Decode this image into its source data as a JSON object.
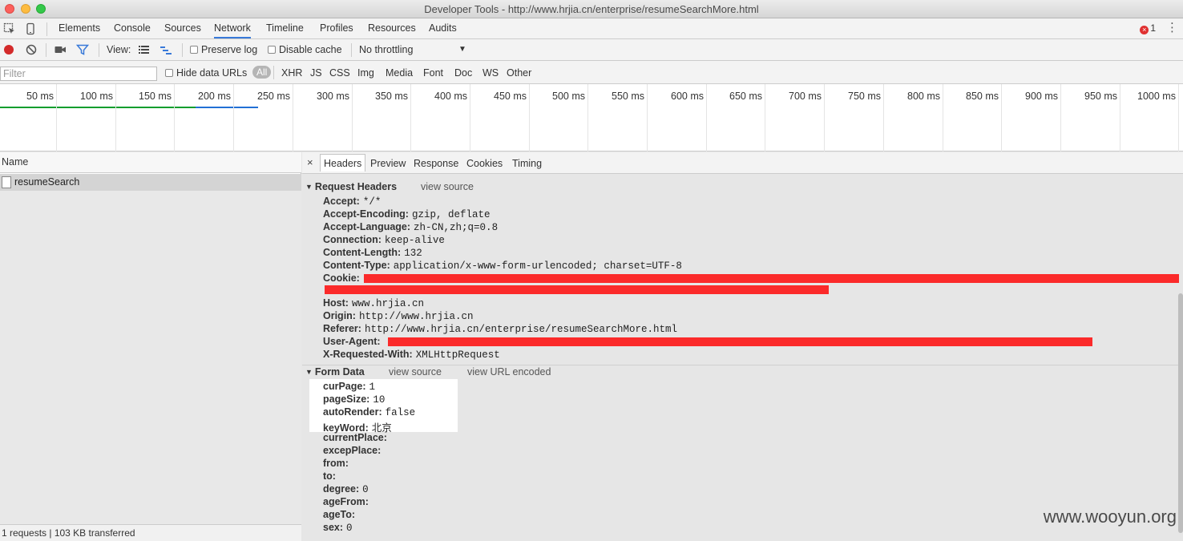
{
  "window": {
    "title": "Developer Tools - http://www.hrjia.cn/enterprise/resumeSearchMore.html"
  },
  "main_tabs": [
    "Elements",
    "Console",
    "Sources",
    "Network",
    "Timeline",
    "Profiles",
    "Resources",
    "Audits"
  ],
  "active_main_tab": "Network",
  "error_count": "1",
  "toolbar": {
    "view_label": "View:",
    "preserve_log": "Preserve log",
    "disable_cache": "Disable cache",
    "throttling": "No throttling",
    "preserve_log_checked": false,
    "disable_cache_checked": false
  },
  "filter": {
    "placeholder": "Filter",
    "hide_data_urls": "Hide data URLs",
    "types": [
      "All",
      "XHR",
      "JS",
      "CSS",
      "Img",
      "Media",
      "Font",
      "Doc",
      "WS",
      "Other"
    ]
  },
  "timeline": {
    "labels": [
      "50 ms",
      "100 ms",
      "150 ms",
      "200 ms",
      "250 ms",
      "300 ms",
      "350 ms",
      "400 ms",
      "450 ms",
      "500 ms",
      "550 ms",
      "600 ms",
      "650 ms",
      "700 ms",
      "750 ms",
      "800 ms",
      "850 ms",
      "900 ms",
      "950 ms",
      "1000 ms"
    ]
  },
  "requests": {
    "column_name": "Name",
    "items": [
      "resumeSearch"
    ],
    "status": "1 requests | 103 KB transferred"
  },
  "details": {
    "tabs": [
      "Headers",
      "Preview",
      "Response",
      "Cookies",
      "Timing"
    ],
    "active_tab": "Headers",
    "close": "×",
    "request_headers_title": "Request Headers",
    "view_source": "view source",
    "view_url_encoded": "view URL encoded",
    "form_data_title": "Form Data",
    "request_headers": [
      {
        "key": "Accept:",
        "value": "*/*"
      },
      {
        "key": "Accept-Encoding:",
        "value": "gzip, deflate"
      },
      {
        "key": "Accept-Language:",
        "value": "zh-CN,zh;q=0.8"
      },
      {
        "key": "Connection:",
        "value": "keep-alive"
      },
      {
        "key": "Content-Length:",
        "value": "132"
      },
      {
        "key": "Content-Type:",
        "value": "application/x-www-form-urlencoded; charset=UTF-8"
      },
      {
        "key": "Cookie:",
        "value": ""
      },
      {
        "key": "Host:",
        "value": "www.hrjia.cn"
      },
      {
        "key": "Origin:",
        "value": "http://www.hrjia.cn"
      },
      {
        "key": "Referer:",
        "value": "http://www.hrjia.cn/enterprise/resumeSearchMore.html"
      },
      {
        "key": "User-Agent:",
        "value": ""
      },
      {
        "key": "X-Requested-With:",
        "value": "XMLHttpRequest"
      }
    ],
    "form_data": [
      {
        "key": "curPage:",
        "value": "1"
      },
      {
        "key": "pageSize:",
        "value": "10"
      },
      {
        "key": "autoRender:",
        "value": "false"
      },
      {
        "key": "keyWord:",
        "value": "北京"
      },
      {
        "key": "currentPlace:",
        "value": ""
      },
      {
        "key": "excepPlace:",
        "value": ""
      },
      {
        "key": "from:",
        "value": ""
      },
      {
        "key": "to:",
        "value": ""
      },
      {
        "key": "degree:",
        "value": "0"
      },
      {
        "key": "ageFrom:",
        "value": ""
      },
      {
        "key": "ageTo:",
        "value": ""
      },
      {
        "key": "sex:",
        "value": "0"
      }
    ]
  },
  "watermark": "www.wooyun.org",
  "colors": {
    "accent": "#3879d9",
    "redaction": "#fb2a2a",
    "record": "#d32a2a"
  }
}
